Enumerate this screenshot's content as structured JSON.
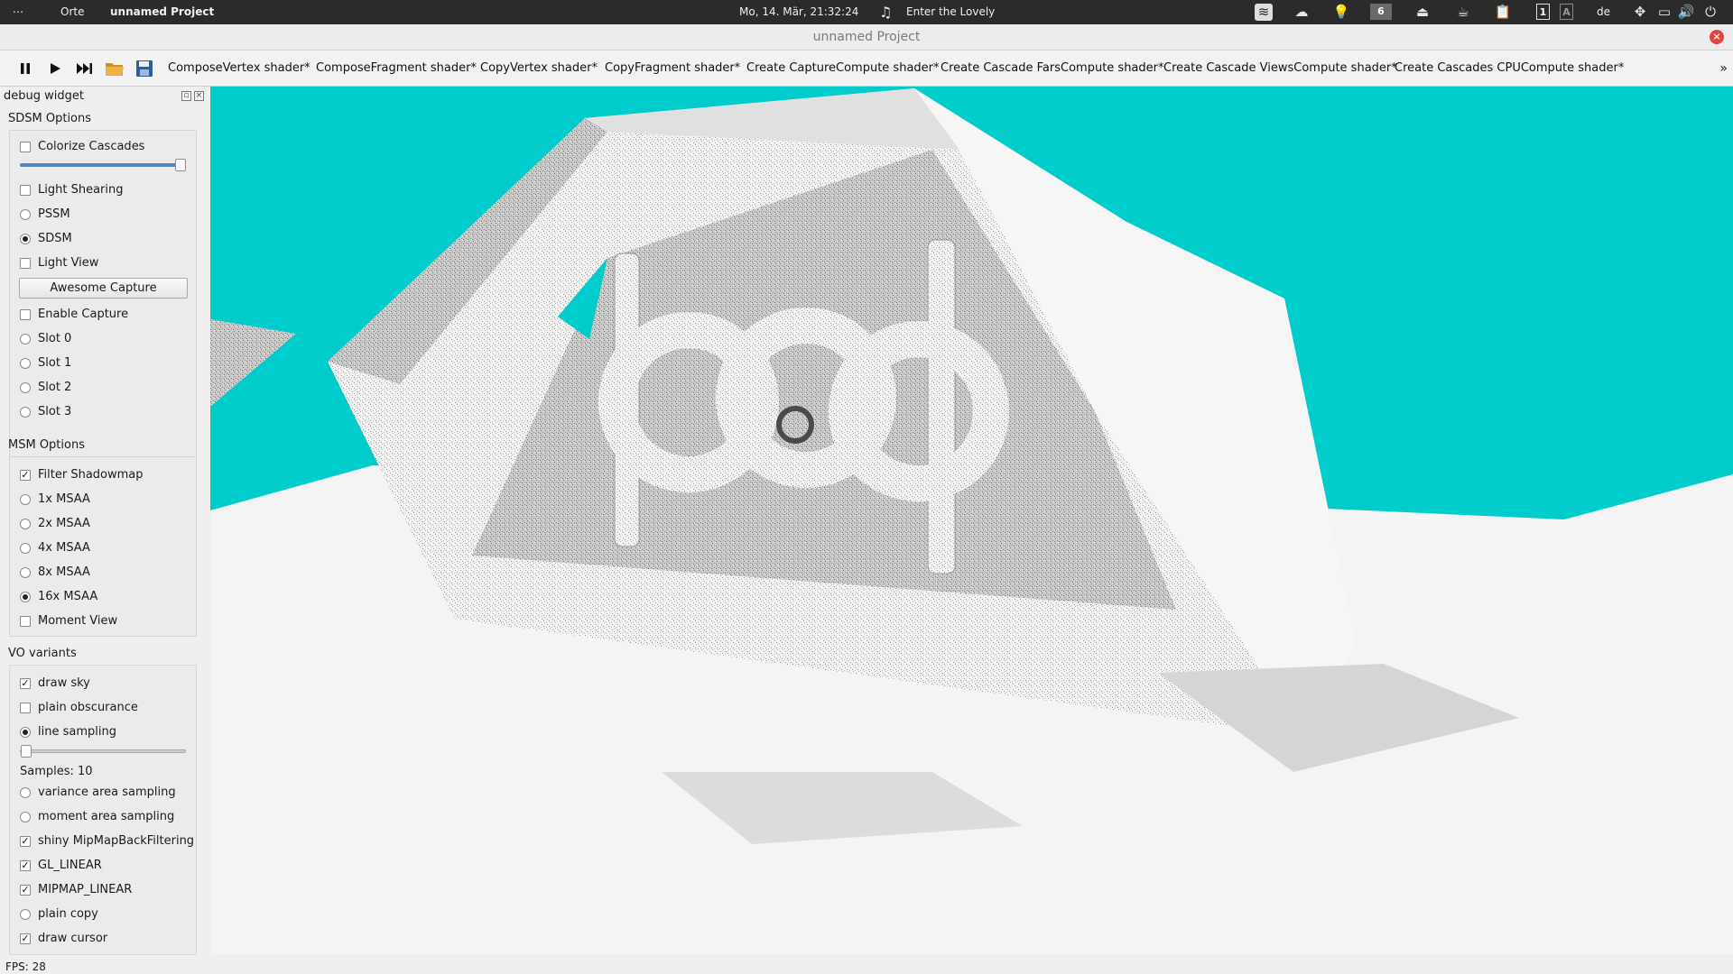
{
  "system_panel": {
    "menu_icon": "ellipsis-icon",
    "places": "Orte",
    "active_app": "unnamed Project",
    "clock": "Mo, 14. Mär, 21:32:24",
    "now_playing": "Enter the Lovely",
    "workspace_number": "6",
    "keyboard_layout": "de",
    "indicator_box_1": "1",
    "indicator_box_2": "A",
    "tray_icons": [
      "spotify-icon",
      "cloud-icon",
      "bulb-icon",
      "eject-icon",
      "coffee-icon",
      "clipboard-icon",
      "network-icon",
      "display-icon",
      "volume-icon",
      "power-icon"
    ]
  },
  "window": {
    "title": "unnamed Project",
    "close_icon": "close-icon"
  },
  "toolbar": {
    "controls": [
      "pause-icon",
      "play-icon",
      "skip-forward-icon",
      "folder-icon",
      "save-icon"
    ],
    "shader_tabs": [
      "ComposeVertex shader*",
      "ComposeFragment shader*",
      "CopyVertex shader*",
      "CopyFragment shader*",
      "Create CaptureCompute shader*",
      "Create Cascade FarsCompute shader*",
      "Create Cascade ViewsCompute shader*",
      "Create Cascades CPUCompute shader*"
    ],
    "more": "»"
  },
  "sidebar": {
    "title": "debug widget",
    "sdsm": {
      "title": "SDSM Options",
      "colorize_cascades": "Colorize Cascades",
      "cascade_slider_value": 1.0,
      "light_shearing": "Light Shearing",
      "pssm": "PSSM",
      "sdsm": "SDSM",
      "light_view": "Light View",
      "awesome_capture": "Awesome Capture",
      "enable_capture": "Enable Capture",
      "slot_0": "Slot 0",
      "slot_1": "Slot 1",
      "slot_2": "Slot 2",
      "slot_3": "Slot 3"
    },
    "msm": {
      "title": "MSM Options",
      "filter_shadowmap": "Filter Shadowmap",
      "msaa_1x": "1x MSAA",
      "msaa_2x": "2x MSAA",
      "msaa_4x": "4x MSAA",
      "msaa_8x": "8x MSAA",
      "msaa_16x": "16x MSAA",
      "moment_view": "Moment View"
    },
    "vo": {
      "title": "VO variants",
      "draw_sky": "draw sky",
      "plain_obscurance": "plain obscurance",
      "line_sampling": "line sampling",
      "samples_slider_value": 0.0,
      "samples_label": "Samples: 10",
      "variance_area_sampling": "variance area sampling",
      "moment_area_sampling": "moment area sampling",
      "shiny_mipmap": "shiny MipMapBackFiltering",
      "gl_linear": "GL_LINEAR",
      "mipmap_linear": "MIPMAP_LINEAR",
      "plain_copy": "plain copy",
      "draw_cursor": "draw cursor"
    },
    "checked_mark": "✓"
  },
  "status": {
    "fps": "FPS: 28"
  },
  "colors": {
    "sky": "#00cccc",
    "panel_bg": "#2b2b2b",
    "close_red": "#e8433d"
  }
}
